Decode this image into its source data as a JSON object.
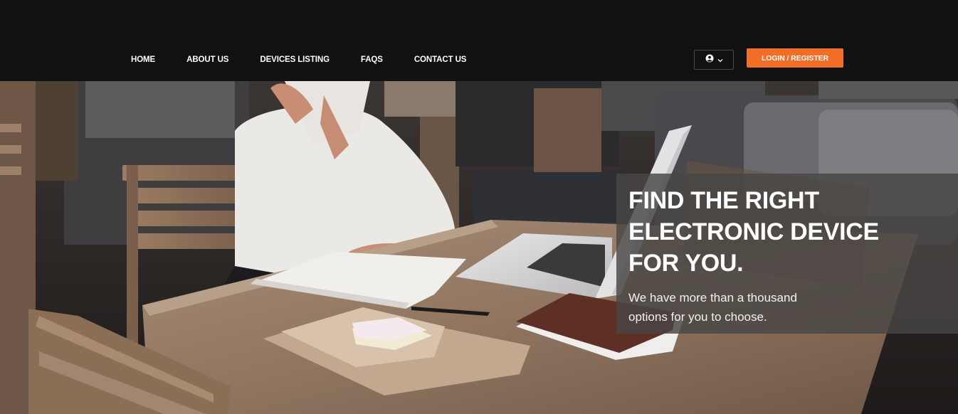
{
  "nav": {
    "items": [
      {
        "label": "HOME"
      },
      {
        "label": "ABOUT US"
      },
      {
        "label": "DEVICES LISTING"
      },
      {
        "label": "FAQS"
      },
      {
        "label": "CONTACT US"
      }
    ]
  },
  "header": {
    "account_icon": "user-circle-icon",
    "dropdown_icon": "chevron-down-icon",
    "login_label": "LOGIN / REGISTER"
  },
  "hero": {
    "title": "FIND THE RIGHT ELECTRONIC DEVICE FOR YOU.",
    "subtitle": "We have more than a thousand options for you to choose.",
    "image": "woman-working-at-cafe-table-photo"
  },
  "colors": {
    "header_bg": "#111111",
    "accent": "#f26d26",
    "panel_bg": "rgba(72,70,68,0.82)",
    "text": "#ffffff"
  }
}
